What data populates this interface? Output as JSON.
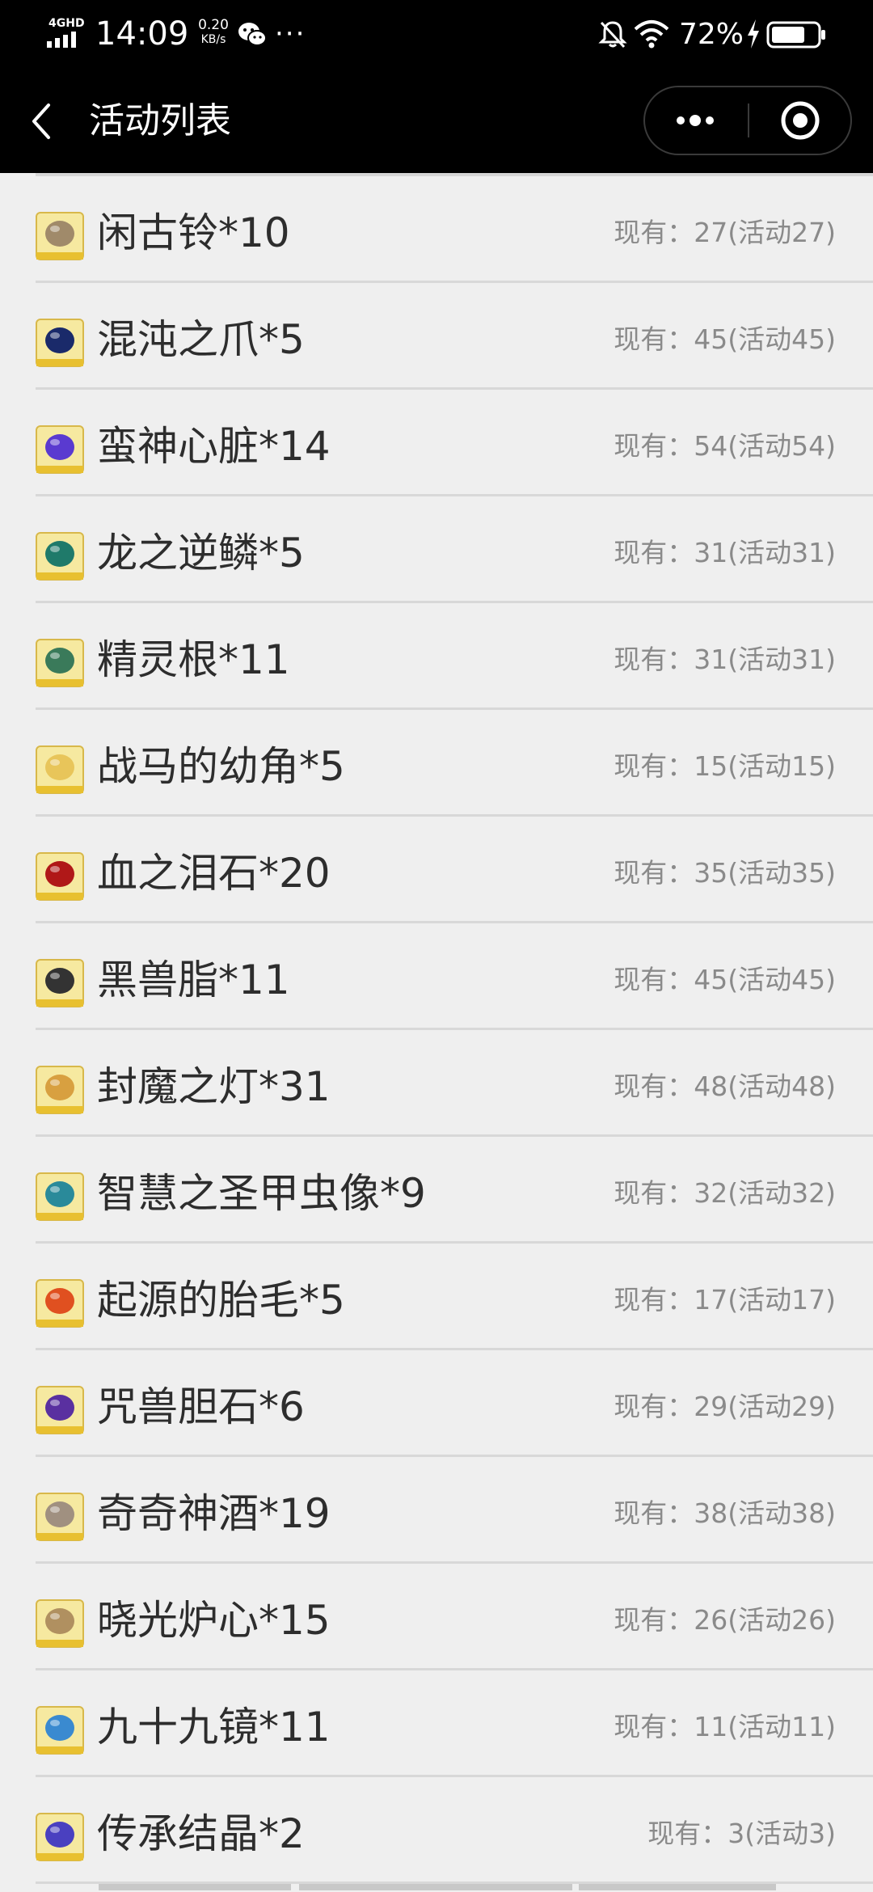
{
  "status_bar": {
    "network": "4GHD",
    "time": "14:09",
    "speed_value": "0.20",
    "speed_unit": "KB/s",
    "more": "···",
    "battery": "72%"
  },
  "nav": {
    "title": "活动列表"
  },
  "items": [
    {
      "name": "闲古铃*10",
      "stock": "现有：27(活动27)",
      "icon": "bell-item-icon",
      "color": "#a08a6a"
    },
    {
      "name": "混沌之爪*5",
      "stock": "现有：45(活动45)",
      "icon": "claw-item-icon",
      "color": "#1a2a6a"
    },
    {
      "name": "蛮神心脏*14",
      "stock": "现有：54(活动54)",
      "icon": "heart-crystal-item-icon",
      "color": "#5a3ad0"
    },
    {
      "name": "龙之逆鳞*5",
      "stock": "现有：31(活动31)",
      "icon": "scale-item-icon",
      "color": "#1f7a6a"
    },
    {
      "name": "精灵根*11",
      "stock": "现有：31(活动31)",
      "icon": "root-item-icon",
      "color": "#3a7a5a"
    },
    {
      "name": "战马的幼角*5",
      "stock": "现有：15(活动15)",
      "icon": "horn-item-icon",
      "color": "#e8c55a"
    },
    {
      "name": "血之泪石*20",
      "stock": "现有：35(活动35)",
      "icon": "blood-stone-item-icon",
      "color": "#b01818"
    },
    {
      "name": "黑兽脂*11",
      "stock": "现有：45(活动45)",
      "icon": "pot-item-icon",
      "color": "#333333"
    },
    {
      "name": "封魔之灯*31",
      "stock": "现有：48(活动48)",
      "icon": "lamp-item-icon",
      "color": "#d8a040"
    },
    {
      "name": "智慧之圣甲虫像*9",
      "stock": "现有：32(活动32)",
      "icon": "scarab-item-icon",
      "color": "#2a8a9a"
    },
    {
      "name": "起源的胎毛*5",
      "stock": "现有：17(活动17)",
      "icon": "feather-item-icon",
      "color": "#e05020"
    },
    {
      "name": "咒兽胆石*6",
      "stock": "现有：29(活动29)",
      "icon": "gallstone-item-icon",
      "color": "#5a30a0"
    },
    {
      "name": "奇奇神酒*19",
      "stock": "现有：38(活动38)",
      "icon": "wine-jar-item-icon",
      "color": "#a09080"
    },
    {
      "name": "晓光炉心*15",
      "stock": "现有：26(活动26)",
      "icon": "furnace-core-item-icon",
      "color": "#b09060"
    },
    {
      "name": "九十九镜*11",
      "stock": "现有：11(活动11)",
      "icon": "mirror-item-icon",
      "color": "#3a8ad0"
    },
    {
      "name": "传承结晶*2",
      "stock": "现有：3(活动3)",
      "icon": "crystal-item-icon",
      "color": "#4a40c0"
    }
  ]
}
